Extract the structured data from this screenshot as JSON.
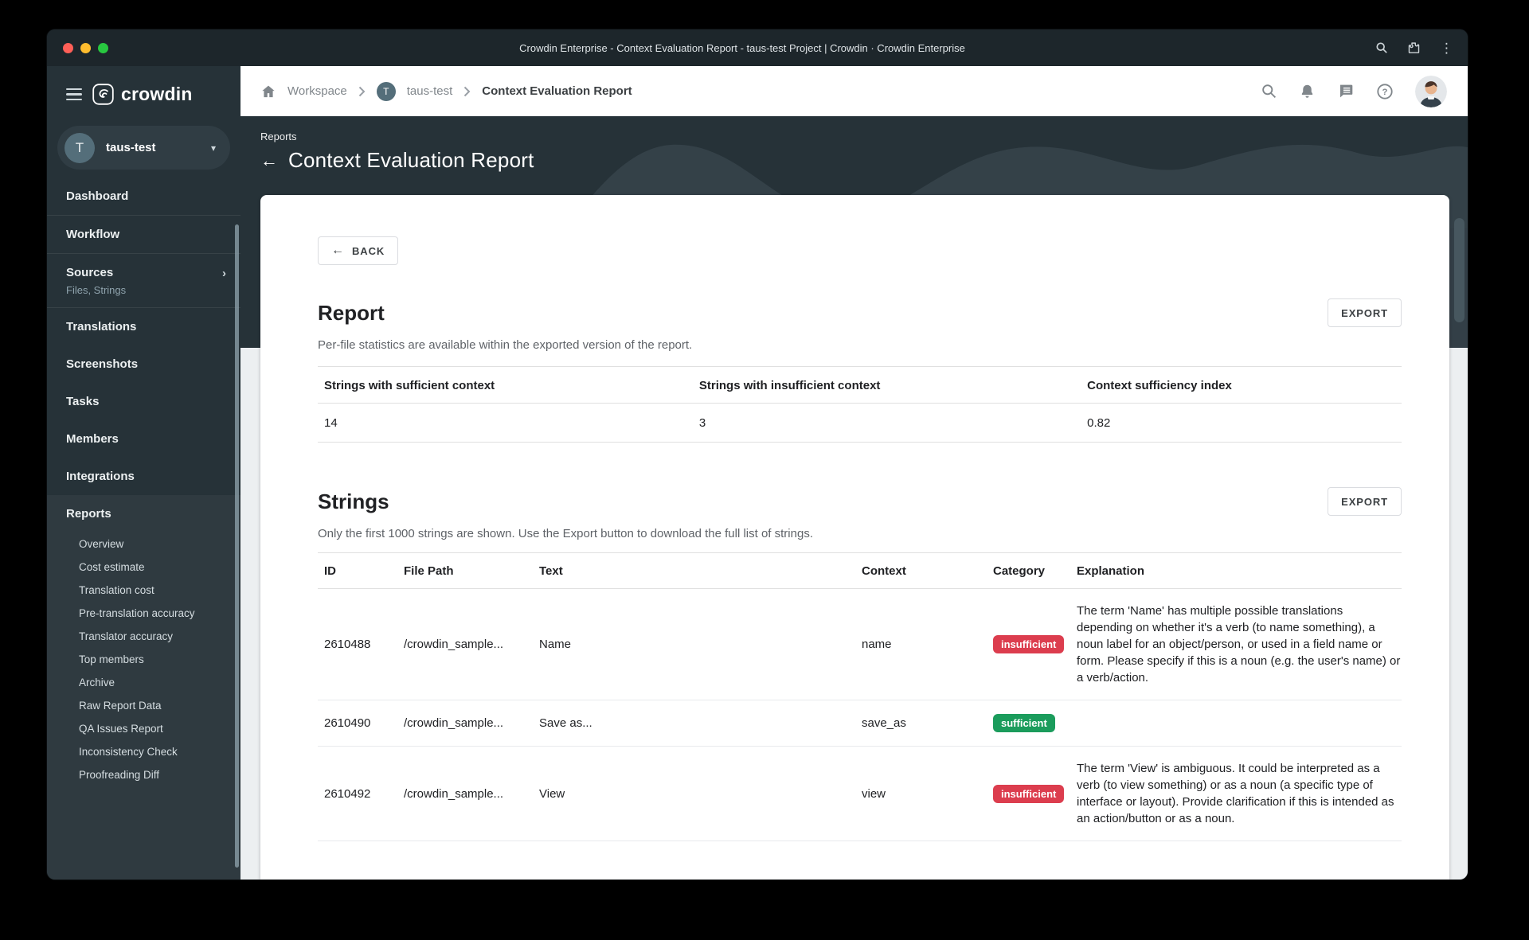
{
  "browser": {
    "title": "Crowdin Enterprise - Context Evaluation Report - taus-test Project | Crowdin · Crowdin Enterprise"
  },
  "breadcrumb": {
    "workspace": "Workspace",
    "project_initial": "T",
    "project": "taus-test",
    "page": "Context Evaluation Report"
  },
  "sidebar": {
    "logo_text": "crowdin",
    "project": {
      "initial": "T",
      "name": "taus-test"
    },
    "items": [
      {
        "label": "Dashboard",
        "divider_after": true
      },
      {
        "label": "Workflow",
        "divider_after": true
      },
      {
        "label": "Sources",
        "sublabel": "Files, Strings",
        "has_chevron": true,
        "divider_after": true
      },
      {
        "label": "Translations"
      },
      {
        "label": "Screenshots"
      },
      {
        "label": "Tasks"
      },
      {
        "label": "Members"
      },
      {
        "label": "Integrations"
      }
    ],
    "reports": {
      "label": "Reports",
      "items": [
        "Overview",
        "Cost estimate",
        "Translation cost",
        "Pre-translation accuracy",
        "Translator accuracy",
        "Top members",
        "Archive",
        "Raw Report Data",
        "QA Issues Report",
        "Inconsistency Check",
        "Proofreading Diff"
      ]
    }
  },
  "page": {
    "eyebrow": "Reports",
    "title": "Context Evaluation Report",
    "back_label": "BACK"
  },
  "report_section": {
    "title": "Report",
    "subtitle": "Per-file statistics are available within the exported version of the report.",
    "export_label": "EXPORT",
    "stats": {
      "headers": [
        "Strings with sufficient context",
        "Strings with insufficient context",
        "Context sufficiency index"
      ],
      "values": [
        "14",
        "3",
        "0.82"
      ]
    }
  },
  "strings_section": {
    "title": "Strings",
    "subtitle": "Only the first 1000 strings are shown. Use the Export button to download the full list of strings.",
    "export_label": "EXPORT",
    "table": {
      "headers": [
        "ID",
        "File Path",
        "Text",
        "Context",
        "Category",
        "Explanation"
      ],
      "rows": [
        {
          "id": "2610488",
          "file_path": "/crowdin_sample...",
          "text": "Name",
          "context": "name",
          "category": "insufficient",
          "explanation": "The term 'Name' has multiple possible translations depending on whether it's a verb (to name something), a noun label for an object/person, or used in a field name or form. Please specify if this is a noun (e.g. the user's name) or a verb/action."
        },
        {
          "id": "2610490",
          "file_path": "/crowdin_sample...",
          "text": "Save as...",
          "context": "save_as",
          "category": "sufficient",
          "explanation": ""
        },
        {
          "id": "2610492",
          "file_path": "/crowdin_sample...",
          "text": "View",
          "context": "view",
          "category": "insufficient",
          "explanation": "The term 'View' is ambiguous. It could be interpreted as a verb (to view something) or as a noun (a specific type of interface or layout). Provide clarification if this is intended as an action/button or as a noun."
        }
      ]
    }
  },
  "icons": {
    "hamburger-icon": "three-bars",
    "chevron-down-icon": "▾",
    "chevron-right-icon": "›",
    "back-arrow-icon": "←",
    "kebab-menu-icon": "⋮"
  },
  "colors": {
    "titlebar_bg": "#1d262b",
    "sidebar_bg": "#263238",
    "band_bg": "#263238",
    "page_bg": "#eceff1",
    "accent_insufficient": "#dc3d4e",
    "accent_sufficient": "#1b9c5c",
    "traffic_red": "#ff5f57",
    "traffic_yellow": "#febc2e",
    "traffic_green": "#28c840"
  }
}
